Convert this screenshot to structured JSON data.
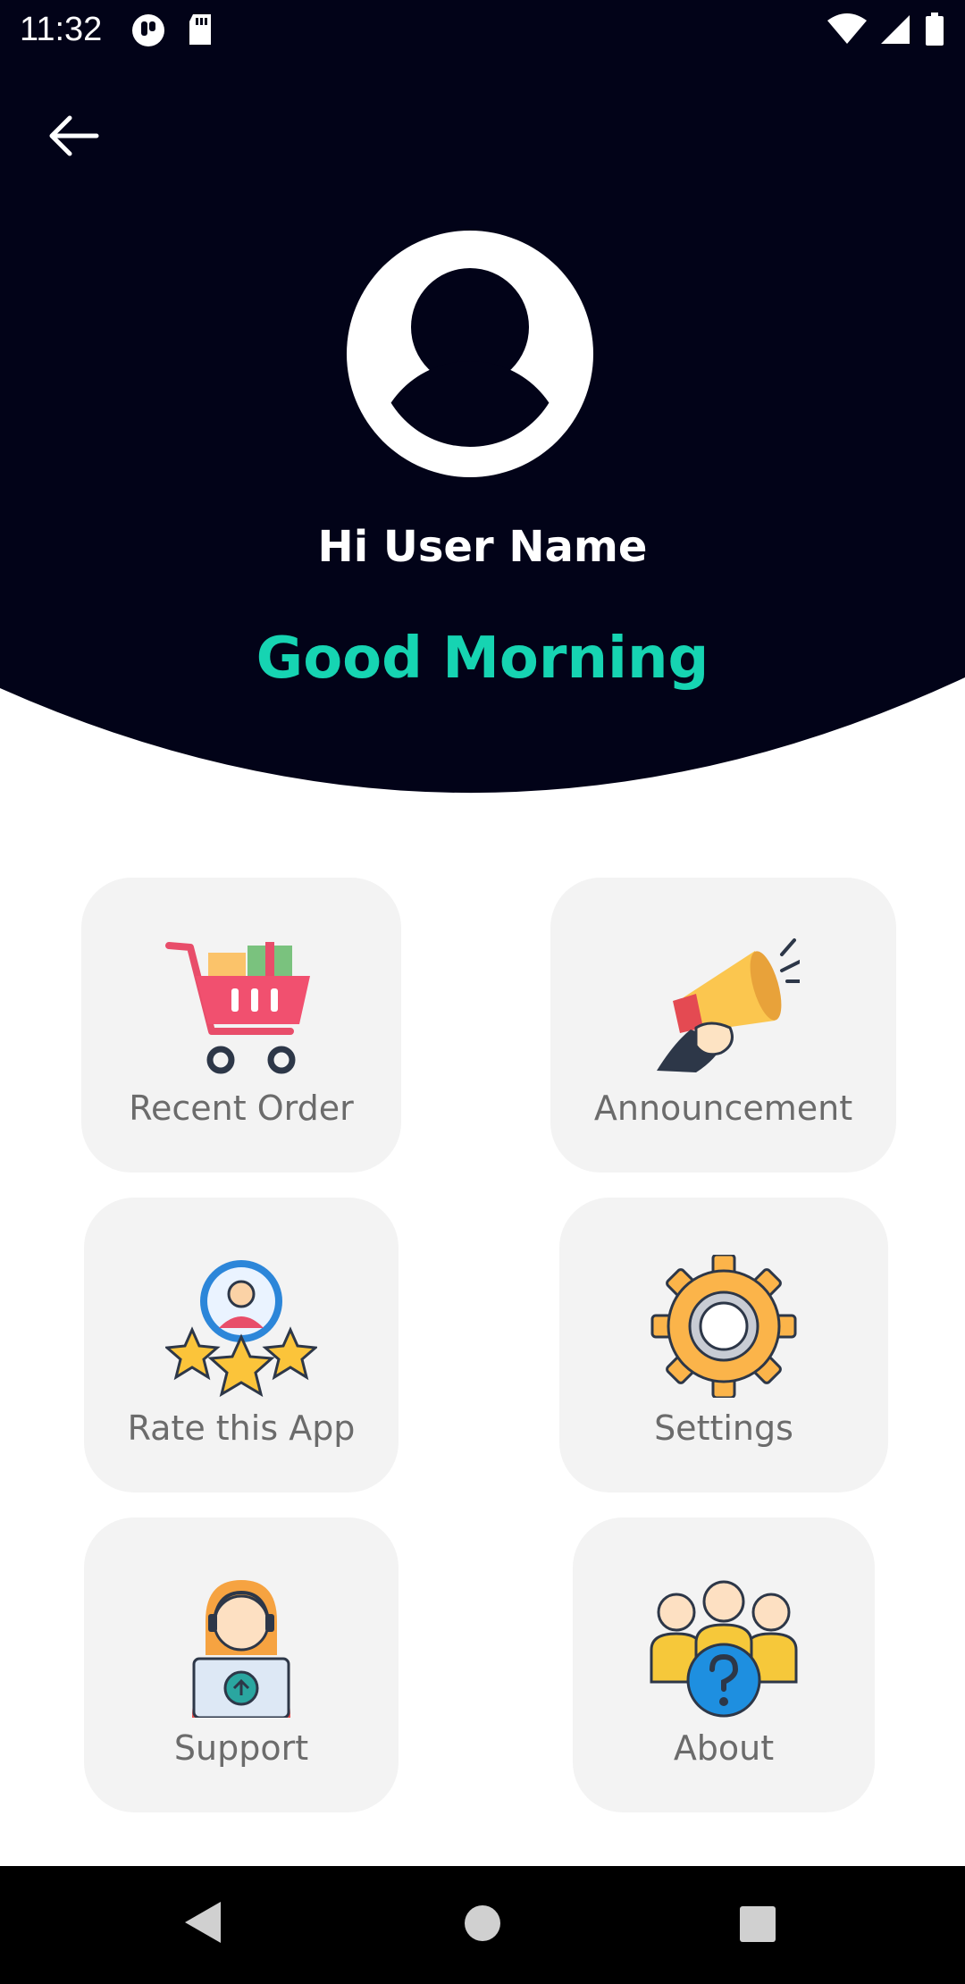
{
  "status_bar": {
    "time": "11:32"
  },
  "profile": {
    "greeting": "Hi User Name",
    "time_of_day": "Good Morning"
  },
  "menu": [
    {
      "label": "Recent Order",
      "icon": "shopping-cart-icon"
    },
    {
      "label": "Announcement",
      "icon": "megaphone-icon"
    },
    {
      "label": "Rate this App",
      "icon": "rating-stars-icon"
    },
    {
      "label": "Settings",
      "icon": "gear-icon"
    },
    {
      "label": "Support",
      "icon": "support-agent-icon"
    },
    {
      "label": "About",
      "icon": "about-group-icon"
    }
  ],
  "colors": {
    "header_bg": "#020318",
    "accent": "#16d4b2",
    "card_bg": "#f3f3f3",
    "label": "#6b6b6b"
  }
}
